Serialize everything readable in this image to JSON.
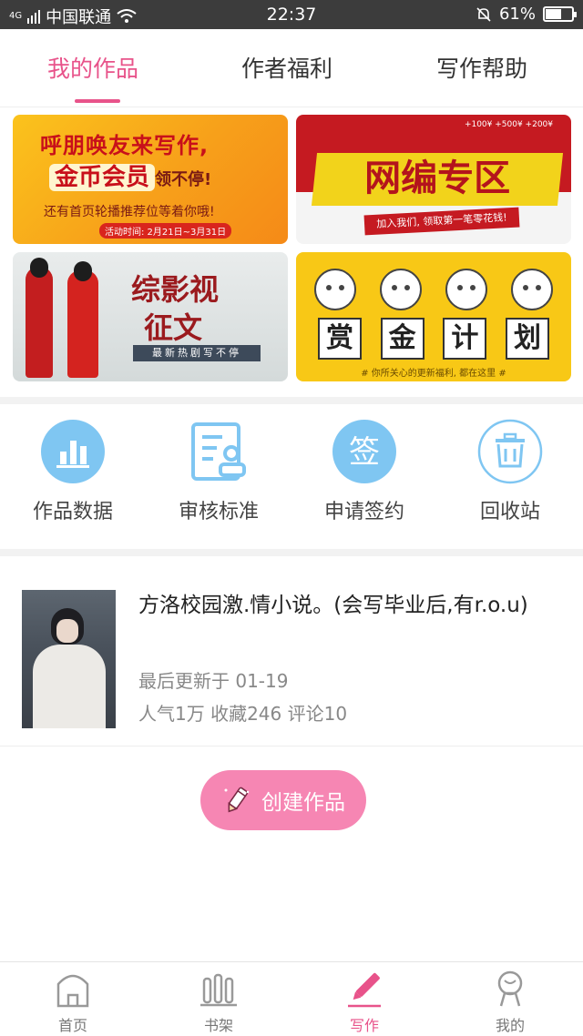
{
  "status_bar": {
    "signal_type": "4G",
    "carrier": "中国联通",
    "time": "22:37",
    "battery": "61%",
    "battery_level": 0.61
  },
  "tabs": [
    {
      "label": "我的作品",
      "active": true
    },
    {
      "label": "作者福利",
      "active": false
    },
    {
      "label": "写作帮助",
      "active": false
    }
  ],
  "banners": {
    "b1": {
      "title": "呼朋唤友来写作,",
      "highlight": "金币会员",
      "highlight_suffix": "领不停!",
      "line": "还有首页轮播推荐位等着你哦!",
      "date": "活动时间: 2月21日~3月31日"
    },
    "b2": {
      "title": "网编专区",
      "ribbon": "加入我们, 领取第一笔零花钱!",
      "money": "+100¥  +500¥  +200¥"
    },
    "b3": {
      "title_line1": "综影视",
      "title_line2": "征文",
      "strip": "最新热剧写不停"
    },
    "b4": {
      "chars": [
        "赏",
        "金",
        "计",
        "划"
      ],
      "footer": "# 你所关心的更新福利, 都在这里 #"
    }
  },
  "tools": [
    {
      "label": "作品数据",
      "icon": "bar-chart-icon"
    },
    {
      "label": "审核标准",
      "icon": "review-document-icon"
    },
    {
      "label": "申请签约",
      "icon": "sign-contract-icon"
    },
    {
      "label": "回收站",
      "icon": "trash-icon"
    }
  ],
  "work": {
    "title": "方洛校园激.情小说。(会写毕业后,有r.o.u)",
    "updated": "最后更新于 01-19",
    "stats": "人气1万 收藏246 评论10"
  },
  "create_button": {
    "label": "创建作品"
  },
  "colors": {
    "accent": "#e8538a",
    "button": "#f686b3",
    "tool_icon_blue": "#7fc6f2"
  },
  "bottom_nav": [
    {
      "label": "首页",
      "icon": "home-icon",
      "active": false
    },
    {
      "label": "书架",
      "icon": "bookshelf-icon",
      "active": false
    },
    {
      "label": "写作",
      "icon": "pen-icon",
      "active": true
    },
    {
      "label": "我的",
      "icon": "profile-icon",
      "active": false
    }
  ]
}
